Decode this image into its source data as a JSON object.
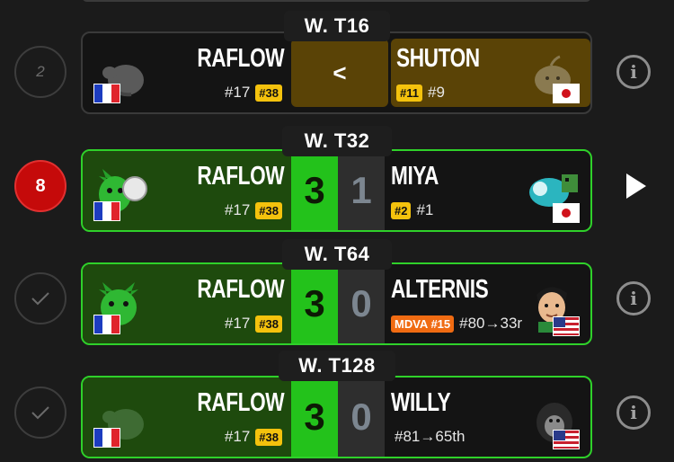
{
  "matches": [
    {
      "round_label": "W. T16",
      "status": {
        "type": "number",
        "text": "2"
      },
      "p1": {
        "name": "RAFLOW",
        "seed": "#17",
        "chip": "#38",
        "flag": "fr",
        "avatar": "blob-avatar-icon"
      },
      "p2": {
        "name": "SHUTON",
        "seed": "#9",
        "chip": "#11",
        "flag": "jp",
        "avatar": "onion-blob-avatar-icon"
      },
      "vs_text": "<",
      "action": "info"
    },
    {
      "round_label": "W. T32",
      "status": {
        "type": "live",
        "text": "8"
      },
      "p1": {
        "name": "RAFLOW",
        "seed": "#17",
        "chip": "#38",
        "flag": "fr",
        "avatar": "green-character-avatar-icon"
      },
      "p2": {
        "name": "MIYA",
        "seed": "#1",
        "chip": "#2",
        "flag": "jp",
        "avatar": "teal-character-avatar-icon"
      },
      "score1": "3",
      "score2": "1",
      "action": "play"
    },
    {
      "round_label": "W. T64",
      "status": {
        "type": "done"
      },
      "p1": {
        "name": "RAFLOW",
        "seed": "#17",
        "chip": "#38",
        "flag": "fr",
        "avatar": "green-character-avatar-icon"
      },
      "p2": {
        "name": "ALTERNIS",
        "seed": "#80→33r",
        "chip": "MDVA #15",
        "flag": "us",
        "avatar": "face-avatar-icon"
      },
      "score1": "3",
      "score2": "0",
      "action": "info"
    },
    {
      "round_label": "W. T128",
      "status": {
        "type": "done"
      },
      "p1": {
        "name": "RAFLOW",
        "seed": "#17",
        "chip": "#38",
        "flag": "fr",
        "avatar": "blob-avatar-icon"
      },
      "p2": {
        "name": "WILLY",
        "seed": "#81→65th",
        "chip": "",
        "flag": "us",
        "avatar": "gorilla-avatar-icon"
      },
      "score1": "3",
      "score2": "0",
      "action": "info"
    }
  ],
  "colors": {
    "win": "#1e4a0d",
    "score_win": "#23c21b",
    "live": "#c50a0a",
    "chip": "#f4c20d",
    "chip_orange": "#f06b12"
  }
}
